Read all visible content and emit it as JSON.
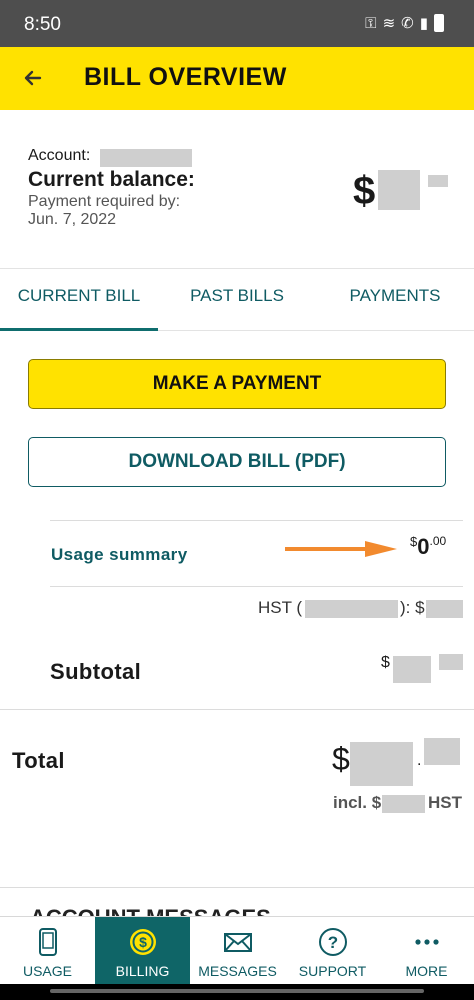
{
  "status_bar": {
    "time": "8:50"
  },
  "header": {
    "title": "BILL OVERVIEW"
  },
  "account": {
    "account_label": "Account:",
    "balance_label": "Current balance:",
    "payment_required_label": "Payment required by:",
    "payment_date": "Jun. 7, 2022",
    "currency_symbol": "$"
  },
  "tabs": [
    {
      "label": "CURRENT BILL",
      "active": true
    },
    {
      "label": "PAST BILLS",
      "active": false
    },
    {
      "label": "PAYMENTS",
      "active": false
    }
  ],
  "actions": {
    "make_payment": "MAKE A PAYMENT",
    "download_bill": "DOWNLOAD BILL (PDF)"
  },
  "bill": {
    "usage_summary_label": "Usage summary",
    "usage_amount_symbol": "$",
    "usage_amount_whole": "0",
    "usage_amount_cents": ".00",
    "hst_label": "HST (",
    "hst_mid": "): $",
    "subtotal_label": "Subtotal",
    "subtotal_symbol": "$",
    "total_label": "Total",
    "total_symbol": "$",
    "total_dot": ".",
    "incl_label": "incl. $",
    "incl_hst": "HST",
    "next_section_partial": "ACCOUNT MESSAGES"
  },
  "bottom_nav": [
    {
      "label": "USAGE",
      "icon": "phone-icon",
      "active": false
    },
    {
      "label": "BILLING",
      "icon": "dollar-coin-icon",
      "active": true
    },
    {
      "label": "MESSAGES",
      "icon": "envelope-icon",
      "active": false
    },
    {
      "label": "SUPPORT",
      "icon": "question-circle-icon",
      "active": false
    },
    {
      "label": "MORE",
      "icon": "more-dots-icon",
      "active": false
    }
  ],
  "colors": {
    "brand_yellow": "#ffe200",
    "brand_teal": "#0f5b63",
    "annotation_arrow": "#f28a2e"
  }
}
